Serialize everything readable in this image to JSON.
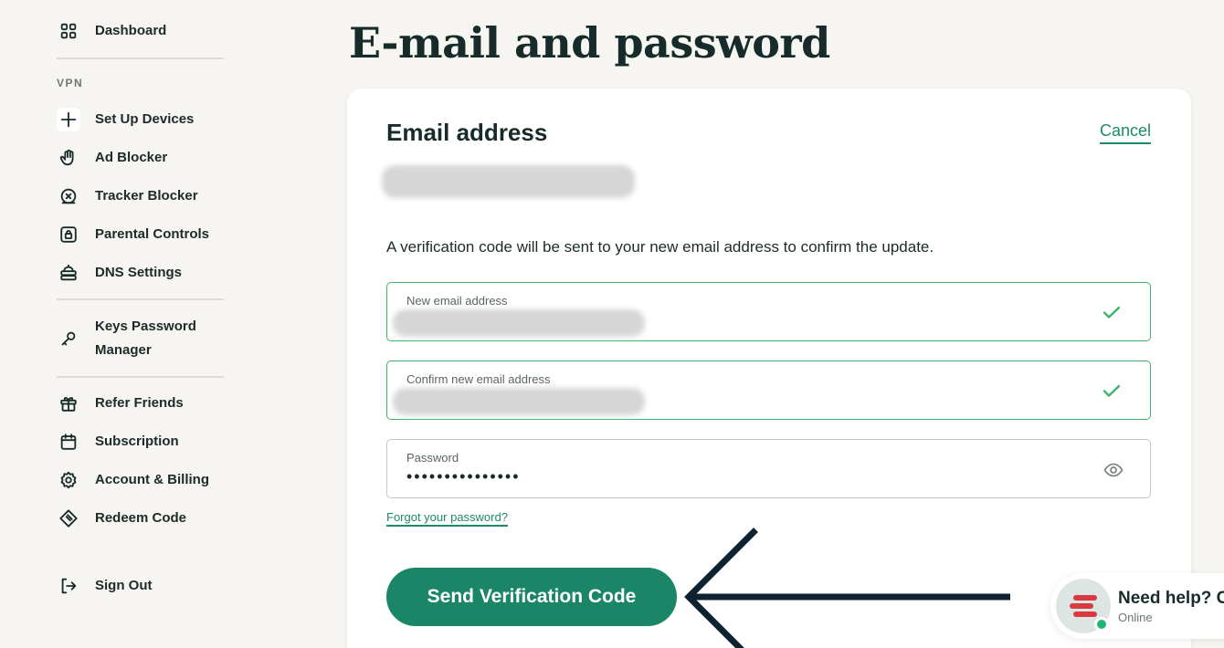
{
  "sidebar": {
    "dashboard": "Dashboard",
    "section_vpn": "VPN",
    "items": {
      "setup_devices": "Set Up Devices",
      "ad_blocker": "Ad Blocker",
      "tracker_blocker": "Tracker Blocker",
      "parental_controls": "Parental Controls",
      "dns_settings": "DNS Settings",
      "keys_password_manager": "Keys Password Manager",
      "refer_friends": "Refer Friends",
      "subscription": "Subscription",
      "account_billing": "Account & Billing",
      "redeem_code": "Redeem Code",
      "sign_out": "Sign Out"
    },
    "icons": {
      "dashboard": "grid-icon",
      "setup_devices": "plus-icon",
      "ad_blocker": "hand-icon",
      "tracker_blocker": "tracker-icon",
      "parental_controls": "lock-icon",
      "dns_settings": "dns-icon",
      "keys_password_manager": "key-icon",
      "refer_friends": "gift-icon",
      "subscription": "calendar-icon",
      "account_billing": "gear-icon",
      "redeem_code": "ticket-icon",
      "sign_out": "sign-out-icon"
    }
  },
  "main": {
    "page_title": "E-mail and password",
    "card": {
      "title": "Email address",
      "cancel_label": "Cancel",
      "info_text": "A verification code will be sent to your new email address to confirm the update.",
      "fields": {
        "new_email_label": "New email address",
        "confirm_email_label": "Confirm new email address",
        "password_label": "Password",
        "password_value": "•••••••••••••••"
      },
      "forgot_password": "Forgot your password?",
      "send_button": "Send Verification Code"
    }
  },
  "help_widget": {
    "title": "Need help? C",
    "status": "Online"
  },
  "colors": {
    "accent": "#1b8667",
    "valid": "#3fb36b",
    "background": "#f6f5f1",
    "text": "#172b2b"
  }
}
